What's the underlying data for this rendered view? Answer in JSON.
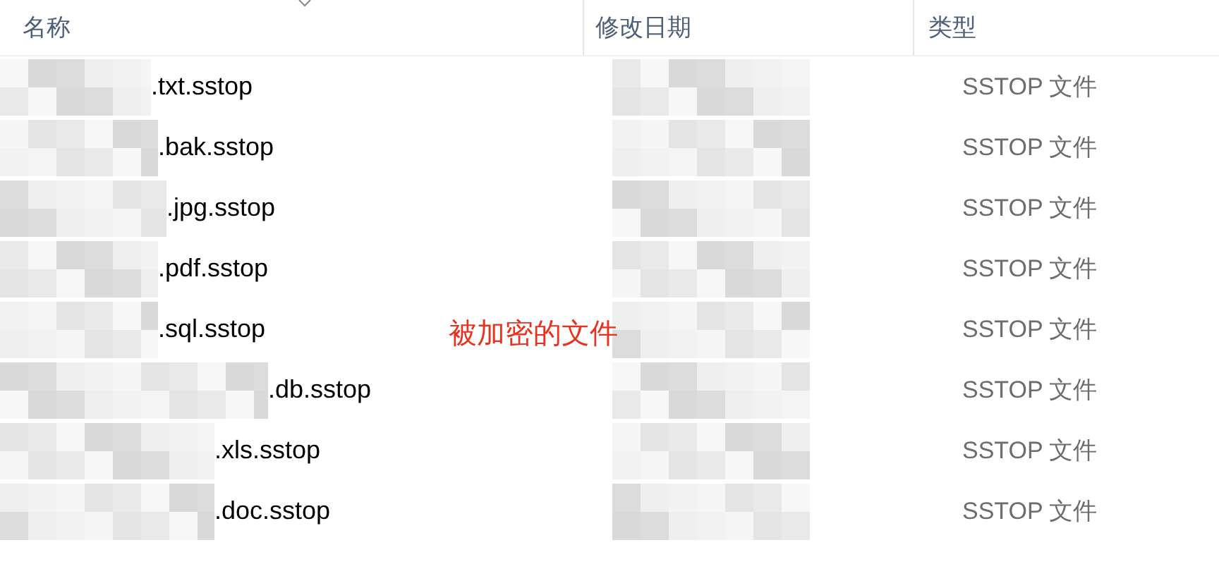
{
  "columns": [
    {
      "label": "名称"
    },
    {
      "label": "修改日期"
    },
    {
      "label": "类型"
    }
  ],
  "rows": [
    {
      "name": ".txt.sstop",
      "type": "SSTOP 文件"
    },
    {
      "name": ".bak.sstop",
      "type": "SSTOP 文件"
    },
    {
      "name": ".jpg.sstop",
      "type": "SSTOP 文件"
    },
    {
      "name": ".pdf.sstop",
      "type": "SSTOP 文件"
    },
    {
      "name": ".sql.sstop",
      "type": "SSTOP 文件"
    },
    {
      "name": ".db.sstop",
      "type": "SSTOP 文件"
    },
    {
      "name": ".xls.sstop",
      "type": "SSTOP 文件"
    },
    {
      "name": ".doc.sstop",
      "type": "SSTOP 文件"
    }
  ],
  "annotation": "被加密的文件"
}
